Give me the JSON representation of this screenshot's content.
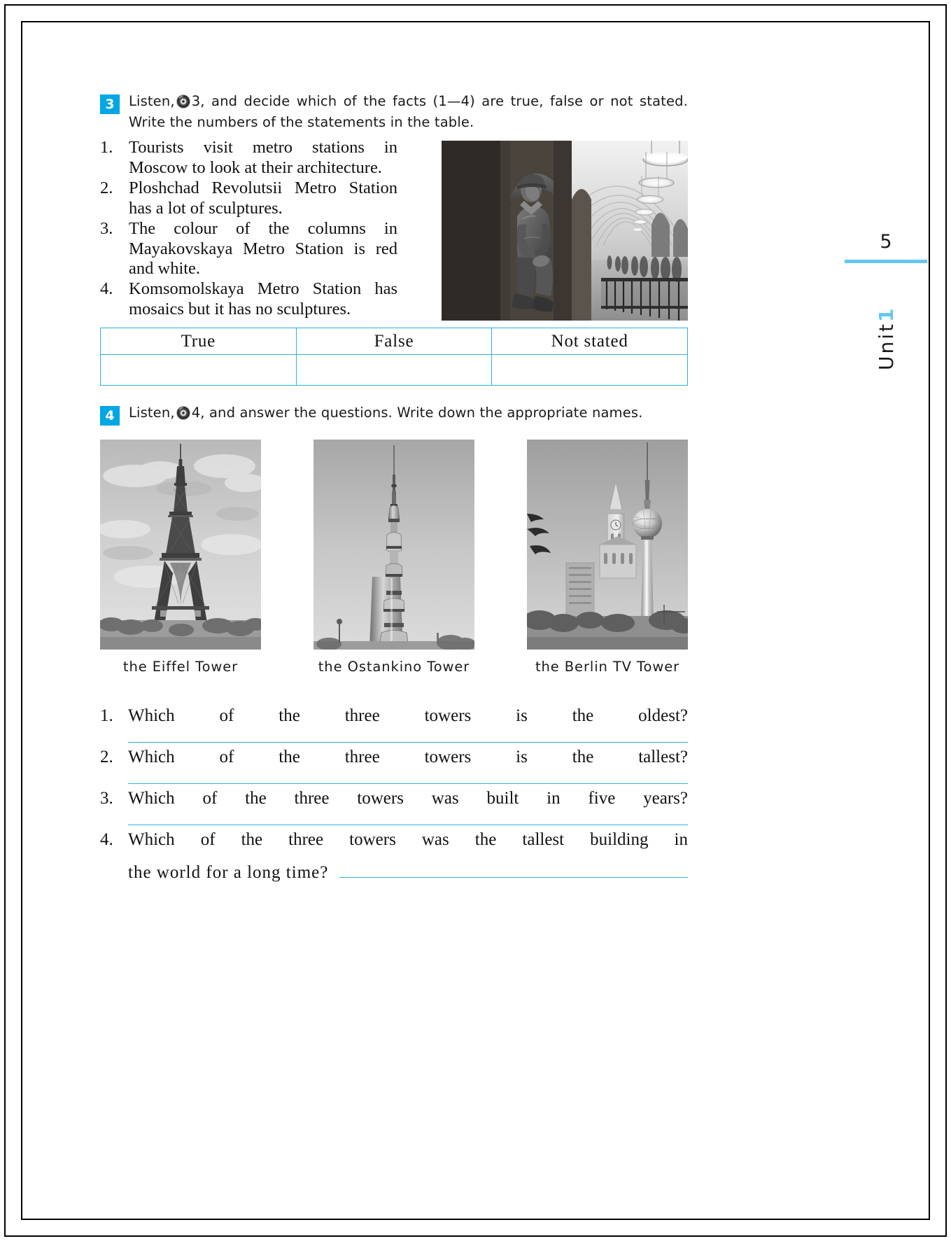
{
  "page": {
    "number": "5",
    "unit_word": "Unit",
    "unit_number": "1",
    "accent_badge": "#00a7e4",
    "accent_rule": "#2bb3d6",
    "accent_tab": "#67c6ef"
  },
  "exercise3": {
    "number": "3",
    "instruction_part1": "Listen,",
    "audio_icon": "cd-icon",
    "instruction_part2": "3, and decide which of the facts (1—4) are true, false or not stated. Write the numbers of the statements in the table.",
    "facts": [
      {
        "marker": "1.",
        "text": "Tourists visit metro stations in Moscow to look at their architecture."
      },
      {
        "marker": "2.",
        "text": "Ploshchad Revolutsii Metro Station has a lot of sculptures."
      },
      {
        "marker": "3.",
        "text": "The colour of the columns in Mayakovskaya Metro Station is red and white."
      },
      {
        "marker": "4.",
        "text": "Komsomolskaya Metro Station has mosaics but it has no sculptures."
      }
    ],
    "photo_caption": "moscow-metro-station-photo",
    "table": {
      "headers": [
        "True",
        "False",
        "Not stated"
      ],
      "rows": [
        [
          "",
          "",
          ""
        ]
      ]
    }
  },
  "exercise4": {
    "number": "4",
    "instruction_part1": "Listen,",
    "audio_icon": "cd-icon",
    "instruction_part2": "4, and answer the questions. Write down the appropriate names.",
    "towers": [
      {
        "caption": "the Eiffel Tower",
        "image_name": "eiffel-tower-photo"
      },
      {
        "caption": "the Ostankino Tower",
        "image_name": "ostankino-tower-photo"
      },
      {
        "caption": "the Berlin TV Tower",
        "image_name": "berlin-tv-tower-photo"
      }
    ],
    "questions": [
      {
        "marker": "1.",
        "text": "Which of the three towers is the oldest?",
        "answer": ""
      },
      {
        "marker": "2.",
        "text": "Which of the three towers is the tallest?",
        "answer": ""
      },
      {
        "marker": "3.",
        "text": "Which of the three towers was built in five years?",
        "answer": ""
      },
      {
        "marker": "4.",
        "line1": "Which of the three towers was the tallest building in",
        "line2": "the world for a long time?",
        "answer": ""
      }
    ]
  }
}
